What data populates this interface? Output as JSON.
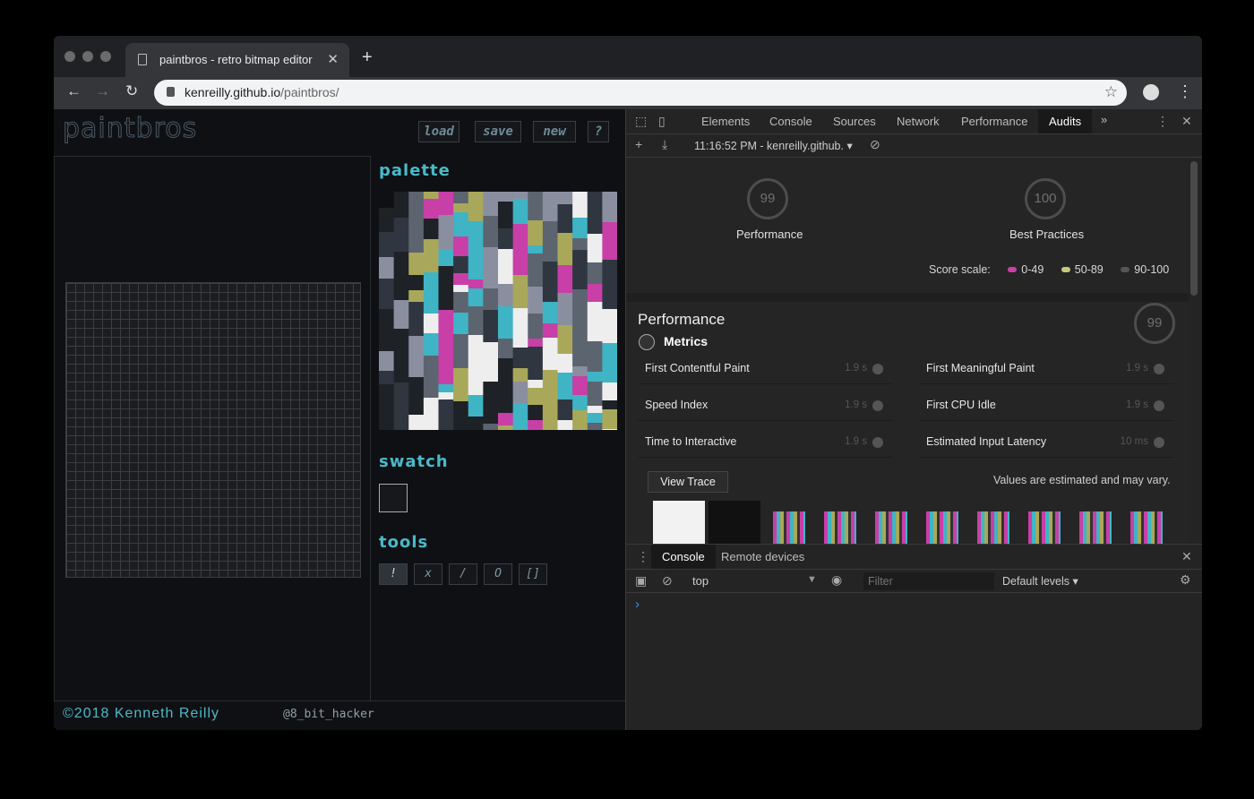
{
  "browser": {
    "tab_title": "paintbros - retro bitmap editor",
    "tab_close": "✕",
    "new_tab": "+",
    "url_host": "kenreilly.github.io",
    "url_path": "/paintbros/",
    "icons": [
      "back-icon",
      "forward-icon",
      "reload-icon",
      "lock-icon",
      "star-icon",
      "account-icon",
      "kebab-menu-icon"
    ]
  },
  "app": {
    "logo": "paintbros",
    "buttons": {
      "load": "load",
      "save": "save",
      "new": "new",
      "help": "?"
    },
    "palette_title": "palette",
    "swatch_title": "swatch",
    "tools_title": "tools",
    "tools": [
      "!",
      "x",
      "/",
      "O",
      "[]"
    ],
    "copyright": "©2018 Kenneth Reilly",
    "handle": "@8_bit_hacker",
    "palette_colors": [
      "#3fb4c5",
      "#c83fa8",
      "#a9a85a",
      "#5c6470",
      "#eeeeee",
      "#1e2226",
      "#2f3640",
      "#8a8fa0"
    ]
  },
  "devtools": {
    "tabs": [
      "Elements",
      "Console",
      "Sources",
      "Network",
      "Performance",
      "Audits"
    ],
    "active_tab": "Audits",
    "more_tabs": "»",
    "report_label": "11:16:52 PM - kenreilly.github.",
    "scores": [
      {
        "value": "99",
        "label": "Performance"
      },
      {
        "value": "100",
        "label": "Best Practices"
      }
    ],
    "score_scale": {
      "label": "Score scale:",
      "ranges": [
        {
          "text": "0-49",
          "color": "#c83fa8"
        },
        {
          "text": "50-89",
          "color": "#c8c87a"
        },
        {
          "text": "90-100",
          "color": "#555555"
        }
      ]
    },
    "perf_title": "Performance",
    "perf_score": "99",
    "metrics_title": "Metrics",
    "metrics": [
      {
        "name": "First Contentful Paint",
        "value": "1.9 s"
      },
      {
        "name": "First Meaningful Paint",
        "value": "1.9 s"
      },
      {
        "name": "Speed Index",
        "value": "1.9 s"
      },
      {
        "name": "First CPU Idle",
        "value": "1.9 s"
      },
      {
        "name": "Time to Interactive",
        "value": "1.9 s"
      },
      {
        "name": "Estimated Input Latency",
        "value": "10 ms"
      }
    ],
    "view_trace": "View Trace",
    "estimate_note": "Values are estimated and may vary.",
    "drawer": {
      "tabs": [
        "Console",
        "Remote devices"
      ],
      "context": "top",
      "filter_placeholder": "Filter",
      "levels": "Default levels",
      "prompt": "›"
    }
  }
}
